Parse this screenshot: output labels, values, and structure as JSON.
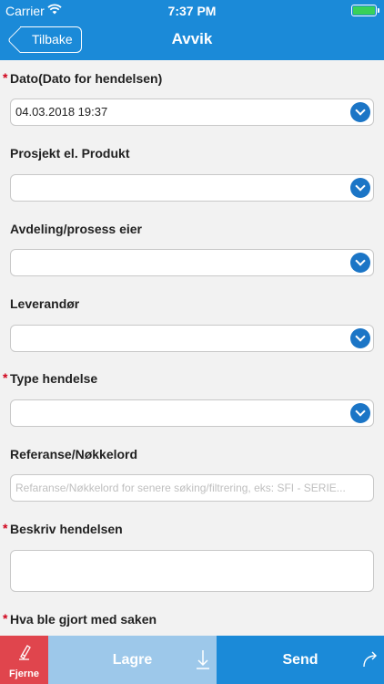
{
  "status_bar": {
    "carrier": "Carrier",
    "time": "7:37 PM"
  },
  "nav": {
    "back_label": "Tilbake",
    "title": "Avvik"
  },
  "form": {
    "fields": [
      {
        "label": "Dato(Dato for hendelsen)",
        "required": true,
        "type": "dropdown",
        "value": "04.03.2018 19:37"
      },
      {
        "label": "Prosjekt el. Produkt",
        "required": false,
        "type": "dropdown",
        "value": ""
      },
      {
        "label": "Avdeling/prosess eier",
        "required": false,
        "type": "dropdown",
        "value": ""
      },
      {
        "label": "Leverandør",
        "required": false,
        "type": "dropdown",
        "value": ""
      },
      {
        "label": "Type hendelse",
        "required": true,
        "type": "dropdown",
        "value": ""
      },
      {
        "label": "Referanse/Nøkkelord",
        "required": false,
        "type": "text",
        "value": "",
        "placeholder": "Refaranse/Nøkkelord for senere søking/filtrering, eks: SFI - SERIE..."
      },
      {
        "label": "Beskriv hendelsen",
        "required": true,
        "type": "textarea",
        "value": ""
      },
      {
        "label": "Hva ble gjort med saken",
        "required": true,
        "type": "textarea",
        "value": ""
      }
    ],
    "required_marker": "*"
  },
  "toolbar": {
    "clear_label": "Fjerne",
    "save_label": "Lagre",
    "send_label": "Send"
  },
  "icons": {
    "wifi": "wifi-icon",
    "battery": "battery-icon",
    "back": "chevron-left-icon",
    "dropdown": "chevron-down-icon",
    "clear": "eraser-icon",
    "save": "download-icon",
    "send": "forward-arrow-icon"
  },
  "colors": {
    "primary": "#1b8ad8",
    "dropdown_icon": "#1b75c6",
    "required": "#d0021b",
    "clear": "#e0454d",
    "save_disabled": "#9dc8ea",
    "battery": "#38d05a"
  }
}
